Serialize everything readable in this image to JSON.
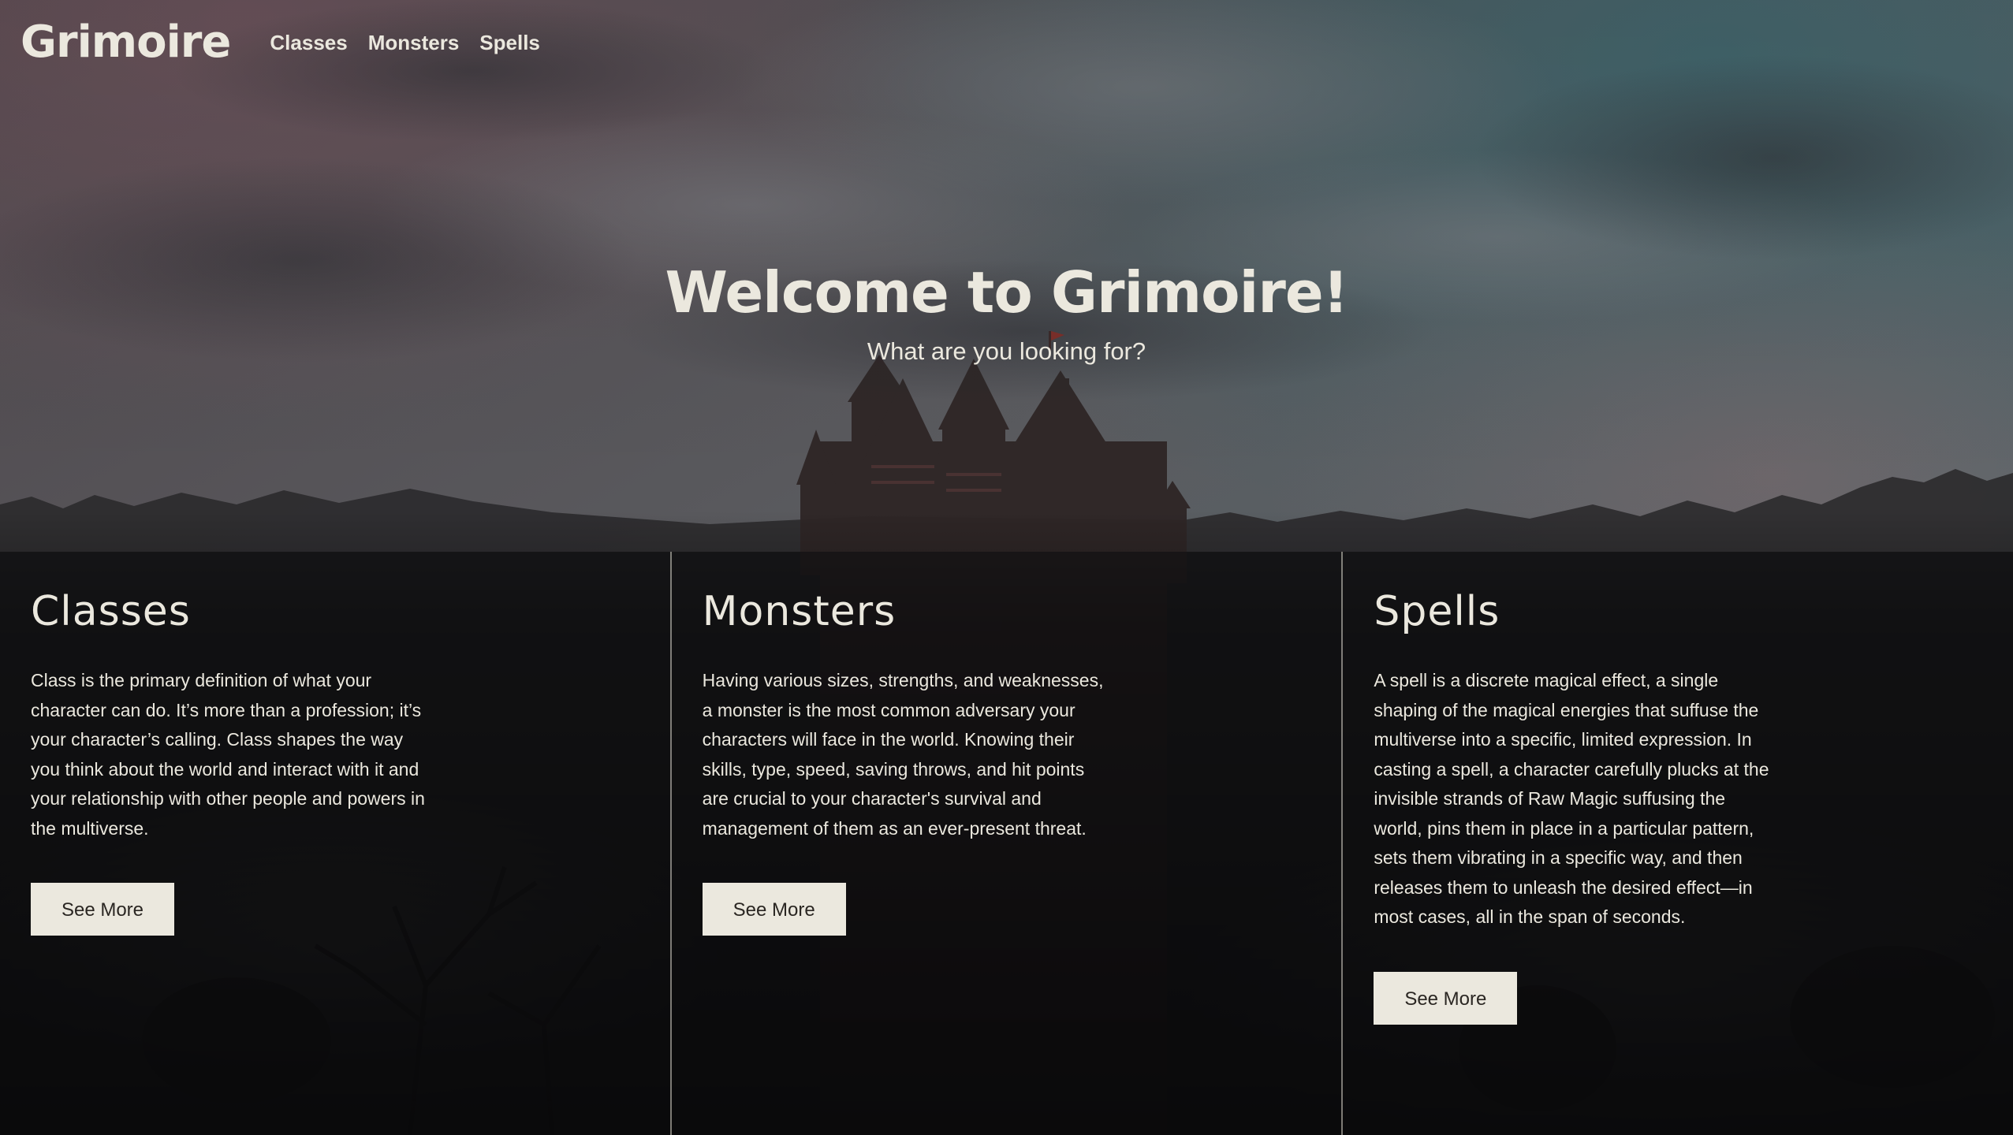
{
  "header": {
    "logo": "Grimoire",
    "nav": [
      {
        "label": "Classes"
      },
      {
        "label": "Monsters"
      },
      {
        "label": "Spells"
      }
    ]
  },
  "hero": {
    "title": "Welcome to Grimoire!",
    "subtitle": "What are you looking for?"
  },
  "cards": [
    {
      "title": "Classes",
      "text": "Class is the primary definition of what your character can do. It’s more than a profession; it’s your character’s calling. Class shapes the way you think about the world and interact with it and your relationship with other people and powers in the multiverse.",
      "button": "See More"
    },
    {
      "title": "Monsters",
      "text": "Having various sizes, strengths, and weaknesses, a monster is the most common adversary your characters will face in the world. Knowing their skills, type, speed, saving throws, and hit points are crucial to your character's survival and management of them as an ever-present threat.",
      "button": "See More"
    },
    {
      "title": "Spells",
      "text": "A spell is a discrete magical effect, a single shaping of the magical energies that suffuse the multiverse into a specific, limited expression. In casting a spell, a character carefully plucks at the invisible strands of Raw Magic suffusing the world, pins them in place in a particular pattern, sets them vibrating in a specific way, and then releases them to unleash the desired effect—in most cases, all in the span of seconds.",
      "button": "See More"
    }
  ],
  "colors": {
    "text": "#ebe8de",
    "button_bg": "#ebe8de",
    "button_text": "#2a2622",
    "divider": "#dcd8cd"
  },
  "background": {
    "image": "castle-at-dusk"
  }
}
